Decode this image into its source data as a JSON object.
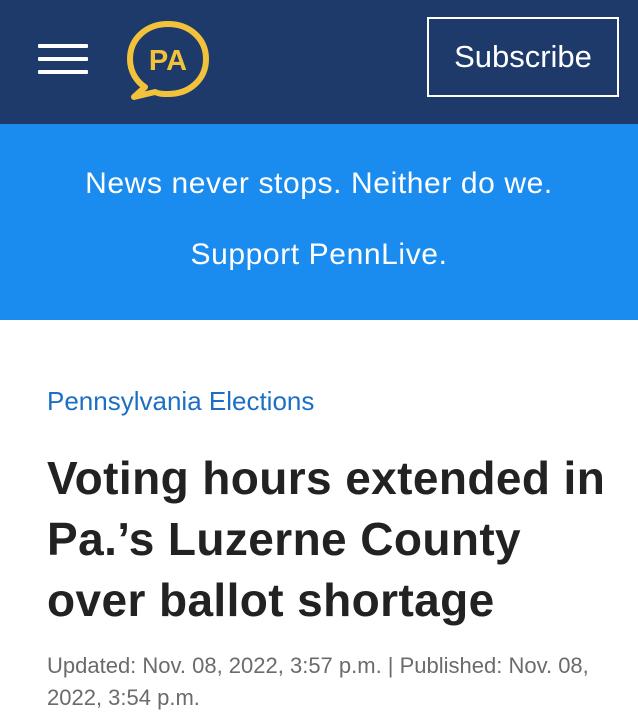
{
  "header": {
    "menu_icon": "hamburger-menu-icon",
    "logo_text": "PA",
    "logo_colors": {
      "ring": "#f2c23a",
      "text": "#f2c23a"
    },
    "subscribe_label": "Subscribe",
    "background": "#1e3a6b"
  },
  "banner": {
    "line1": "News never stops. Neither do we.",
    "line2": "Support PennLive.",
    "background": "#1a8cf0"
  },
  "article": {
    "section": "Pennsylvania Elections",
    "headline": "Voting hours extended in Pa.’s Luzerne County over ballot shortage",
    "byline": "Updated: Nov. 08, 2022, 3:57 p.m. | Published: Nov. 08, 2022, 3:54 p.m."
  }
}
